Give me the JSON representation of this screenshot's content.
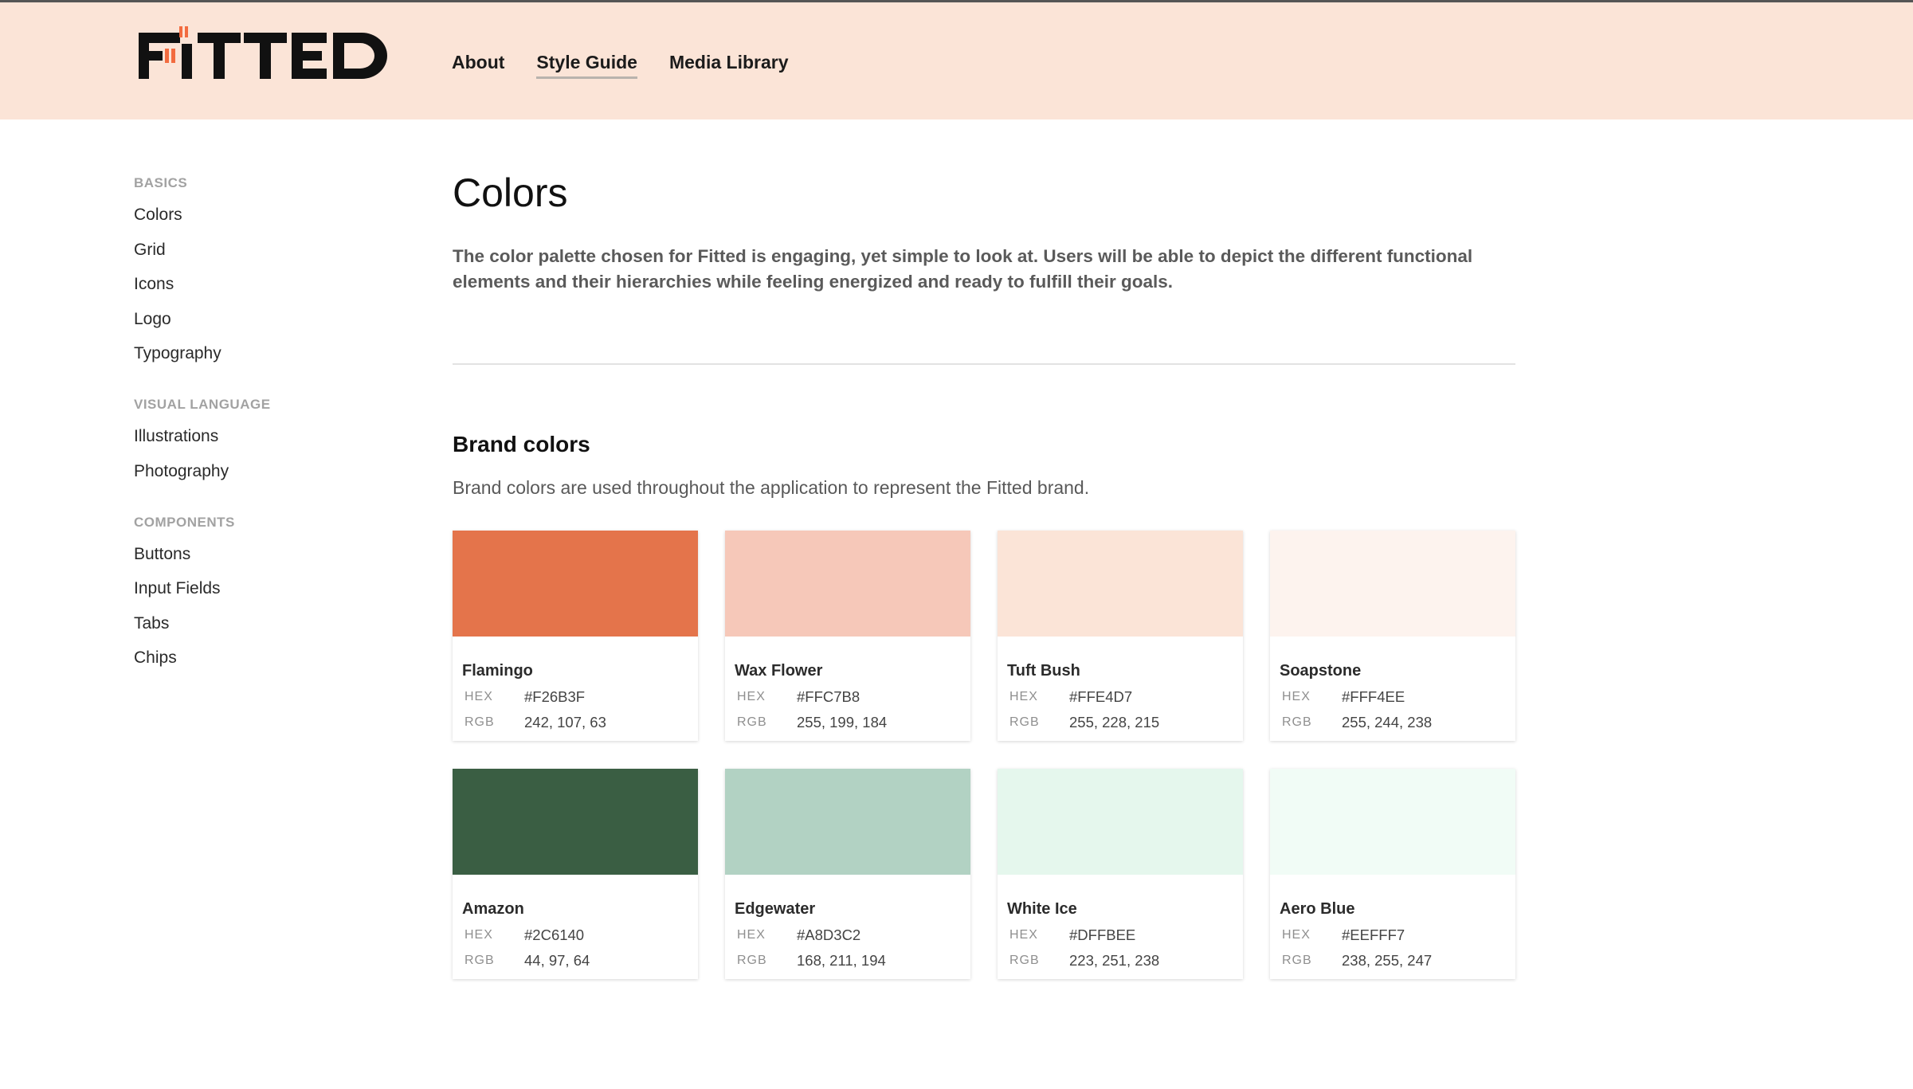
{
  "header": {
    "nav": [
      {
        "label": "About",
        "active": false
      },
      {
        "label": "Style Guide",
        "active": true
      },
      {
        "label": "Media Library",
        "active": false
      }
    ]
  },
  "logo": {
    "text": "FITTED",
    "accent": "#F26B3F",
    "color": "#111111"
  },
  "sidebar": {
    "groups": [
      {
        "heading": "BASICS",
        "items": [
          "Colors",
          "Grid",
          "Icons",
          "Logo",
          "Typography"
        ]
      },
      {
        "heading": "VISUAL LANGUAGE",
        "items": [
          "Illustrations",
          "Photography"
        ]
      },
      {
        "heading": "COMPONENTS",
        "items": [
          "Buttons",
          "Input Fields",
          "Tabs",
          "Chips"
        ]
      }
    ]
  },
  "main": {
    "title": "Colors",
    "intro": "The color palette chosen for Fitted is engaging, yet simple to look at. Users will be able to depict the different functional elements and their hierarchies while feeling energized and ready to fulfill their goals.",
    "section": {
      "title": "Brand colors",
      "description": "Brand colors are used throughout the application to represent the Fitted brand."
    },
    "hex_label": "HEX",
    "rgb_label": "RGB",
    "colors": [
      {
        "name": "Flamingo",
        "hex": "#F26B3F",
        "rgb": "242, 107, 63",
        "swatch": "#E4744B"
      },
      {
        "name": "Wax Flower",
        "hex": "#FFC7B8",
        "rgb": "255, 199, 184",
        "swatch": "#F6C8B9"
      },
      {
        "name": "Tuft Bush",
        "hex": "#FFE4D7",
        "rgb": "255, 228, 215",
        "swatch": "#FBE4D7"
      },
      {
        "name": "Soapstone",
        "hex": "#FFF4EE",
        "rgb": "255, 244, 238",
        "swatch": "#FDF3EE"
      },
      {
        "name": "Amazon",
        "hex": "#2C6140",
        "rgb": "44, 97, 64",
        "swatch": "#3A5E43"
      },
      {
        "name": "Edgewater",
        "hex": "#A8D3C2",
        "rgb": "168, 211, 194",
        "swatch": "#B2D2C3"
      },
      {
        "name": "White Ice",
        "hex": "#DFFBEE",
        "rgb": "223, 251, 238",
        "swatch": "#E5F7ED"
      },
      {
        "name": "Aero Blue",
        "hex": "#EEFFF7",
        "rgb": "238, 255, 247",
        "swatch": "#F1FCF6"
      }
    ]
  }
}
